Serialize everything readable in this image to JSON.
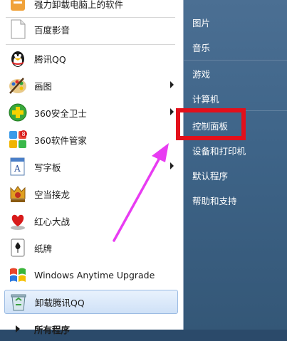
{
  "left_menu": {
    "top_item": "强力卸载电脑上的软件",
    "items": [
      {
        "label": "百度影音",
        "icon": "baidu-player-icon",
        "submenu": false
      },
      {
        "label": "腾讯QQ",
        "icon": "qq-penguin-icon",
        "submenu": false
      },
      {
        "label": "画图",
        "icon": "paint-icon",
        "submenu": true
      },
      {
        "label": "360安全卫士",
        "icon": "360-security-icon",
        "submenu": true
      },
      {
        "label": "360软件管家",
        "icon": "360-software-manager-icon",
        "submenu": false
      },
      {
        "label": "写字板",
        "icon": "wordpad-icon",
        "submenu": true
      },
      {
        "label": "空当接龙",
        "icon": "freecell-icon",
        "submenu": false
      },
      {
        "label": "红心大战",
        "icon": "hearts-icon",
        "submenu": false
      },
      {
        "label": "纸牌",
        "icon": "solitaire-icon",
        "submenu": false
      },
      {
        "label": "Windows Anytime Upgrade",
        "icon": "windows-upgrade-icon",
        "submenu": false
      },
      {
        "label": "卸载腾讯QQ",
        "icon": "recycle-bin-icon",
        "submenu": false
      }
    ],
    "all_programs": "所有程序"
  },
  "right_menu": {
    "items": [
      "图片",
      "音乐",
      "游戏",
      "计算机",
      "控制面板",
      "设备和打印机",
      "默认程序",
      "帮助和支持"
    ]
  },
  "colors": {
    "highlight_box": "#e3101b",
    "arrow": "#e83cf2"
  }
}
